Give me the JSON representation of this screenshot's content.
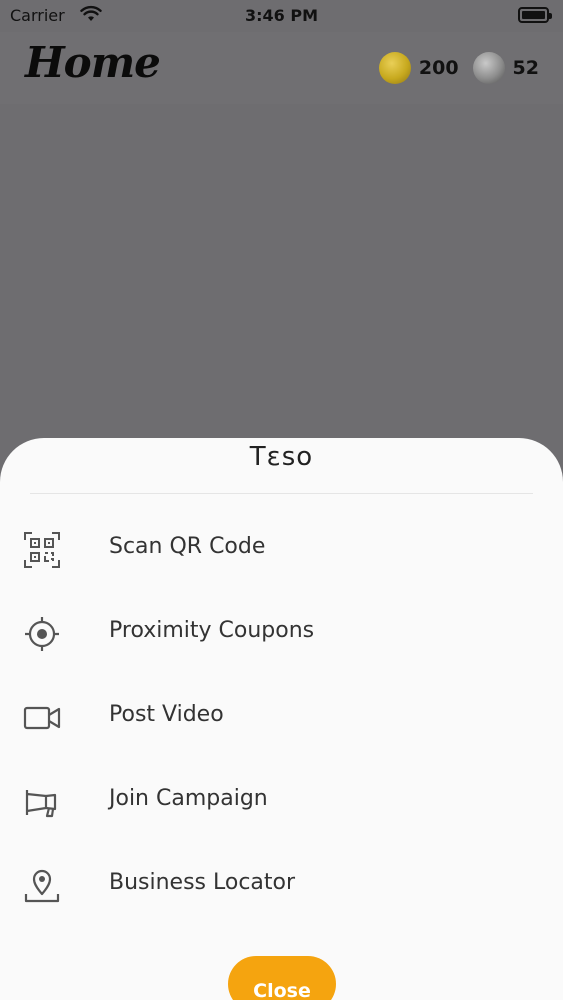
{
  "status_bar": {
    "carrier": "Carrier",
    "time": "3:46 PM"
  },
  "header": {
    "title": "Home",
    "gold_coins": "200",
    "silver_coins": "52"
  },
  "sheet": {
    "title": "Tεso",
    "items": [
      {
        "label": "Scan QR Code",
        "icon": "qr-scan-icon"
      },
      {
        "label": "Proximity Coupons",
        "icon": "target-icon"
      },
      {
        "label": "Post Video",
        "icon": "video-camera-icon"
      },
      {
        "label": "Join Campaign",
        "icon": "megaphone-icon"
      },
      {
        "label": "Business Locator",
        "icon": "location-pin-icon"
      }
    ],
    "close_label": "Close"
  },
  "colors": {
    "accent": "#f5a40f",
    "overlay": "#6e6d70",
    "sheet_bg": "#fafafa"
  }
}
